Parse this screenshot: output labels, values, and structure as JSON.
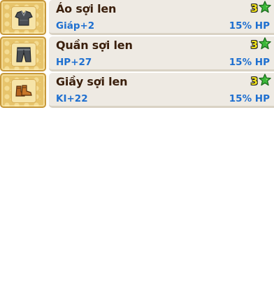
{
  "items": [
    {
      "name": "Áo sợi len",
      "stat": "Giáp+2",
      "hp": "15% HP",
      "star_count": "3",
      "icon": "shirt-icon"
    },
    {
      "name": "Quần sợi len",
      "stat": "HP+27",
      "hp": "15% HP",
      "star_count": "3",
      "icon": "pants-icon"
    },
    {
      "name": "Giầy sợi len",
      "stat": "KI+22",
      "hp": "15% HP",
      "star_count": "3",
      "icon": "boots-icon"
    }
  ],
  "colors": {
    "name": "#3a1f0c",
    "stat": "#1e6fd0",
    "star_count": "#f2e31a",
    "star": "#3cb83a",
    "tile": "#e7c46b",
    "panel": "#eeeae3"
  }
}
